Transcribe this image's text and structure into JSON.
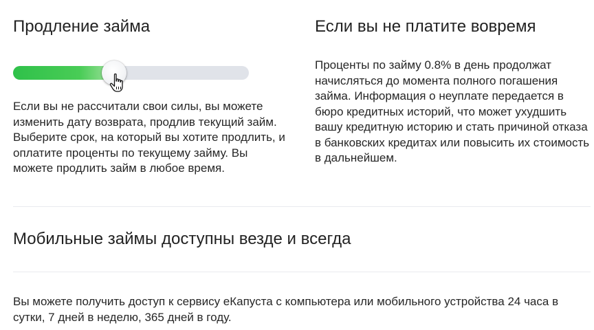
{
  "extension": {
    "title": "Продление займа",
    "text": "Если вы не рассчитали свои силы, вы можете изменить дату возврата, продлив текущий займ. Выберите срок, на который вы хотите продлить, и оплатите проценты по текущему займу. Вы можете продлить займ в любое время.",
    "slider": {
      "fill_fraction": 0.43,
      "fill_color": "#2fc14a",
      "track_color": "#e0e3e9"
    },
    "cursor_icon": "hand-pointer-icon"
  },
  "late_payment": {
    "title": "Если вы не платите вовремя",
    "text": "Проценты по займу 0.8% в день продолжат начисляться до момента полного погашения займа. Информация о неуплате передается в бюро кредитных историй, что может ухудшить вашу кредитную историю и стать причиной отказа в банковских кредитах или повысить их стоимость в дальнейшем."
  },
  "mobile": {
    "title": "Мобильные займы доступны везде и всегда",
    "text": "Вы можете получить доступ к сервису еКапуста с компьютера или мобильного устройства 24 часа в сутки, 7 дней в неделю, 365 дней в году."
  }
}
